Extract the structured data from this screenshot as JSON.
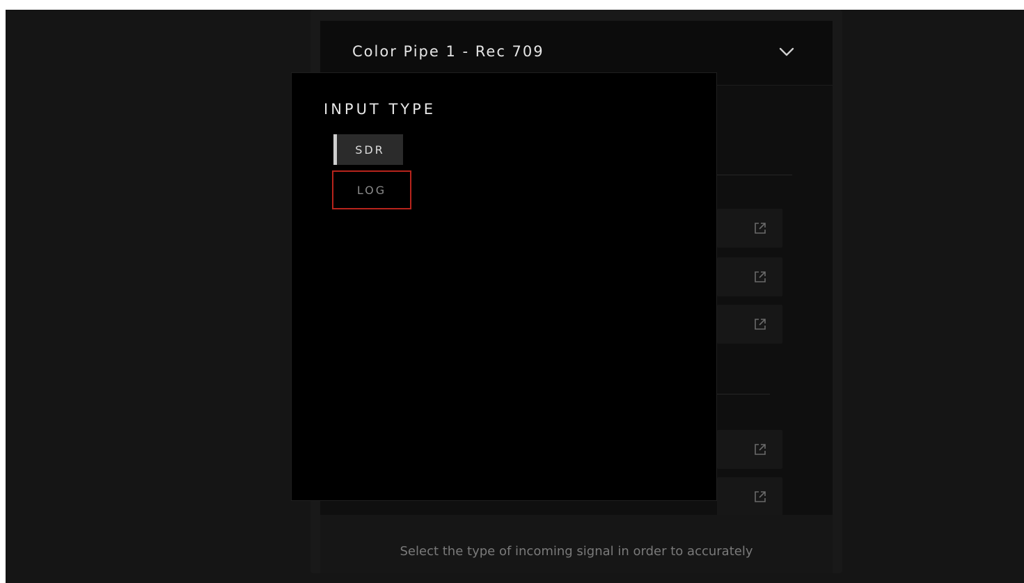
{
  "panel": {
    "title": "Color Pipe 1 - Rec 709",
    "chevron_icon": "chevron-down-icon",
    "row_icon": "external-link-icon",
    "footer_text": "Select the type of incoming signal in order to accurately"
  },
  "popup": {
    "title": "INPUT TYPE",
    "options": [
      {
        "label": "SDR",
        "selected": true
      },
      {
        "label": "LOG",
        "selected": false,
        "focused": true
      }
    ]
  },
  "colors": {
    "focus_outline": "#b8241c",
    "selected_indicator": "#cfcfcf"
  }
}
